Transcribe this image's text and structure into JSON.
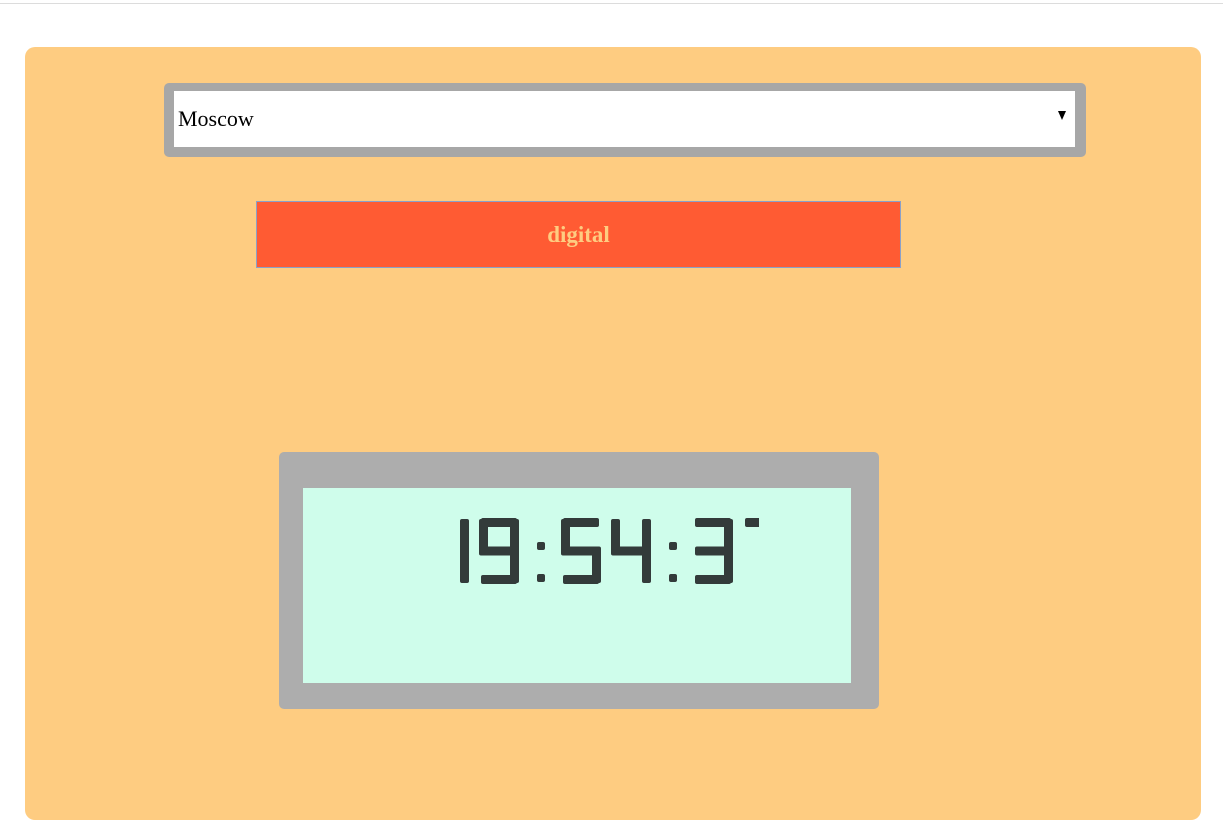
{
  "city_select": {
    "selected": "Moscow"
  },
  "mode_button": {
    "label": "digital"
  },
  "clock": {
    "time": "19:54:37",
    "digit_color": "#333b3a",
    "screen_color": "#cffdeb"
  },
  "colors": {
    "panel": "#fecc81",
    "button": "#ff5b33",
    "frame": "#adadad"
  }
}
